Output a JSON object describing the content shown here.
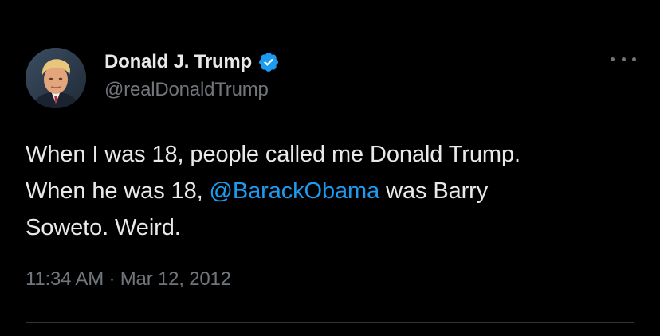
{
  "author": {
    "display_name": "Donald J. Trump",
    "handle": "@realDonaldTrump",
    "verified": true
  },
  "tweet": {
    "line1": "When I was 18, people called me Donald Trump.",
    "line2_prefix": "When he was 18, ",
    "mention": "@BarackObama",
    "line2_suffix": " was Barry",
    "line3": "Soweto. Weird."
  },
  "meta": {
    "time": "11:34 AM",
    "separator": "·",
    "date": "Mar 12, 2012"
  },
  "icons": {
    "verified": "verified-badge-icon",
    "more": "more-options-icon"
  },
  "colors": {
    "background": "#000000",
    "text": "#e7e9ea",
    "muted": "#71767b",
    "accent": "#1d9bf0"
  }
}
